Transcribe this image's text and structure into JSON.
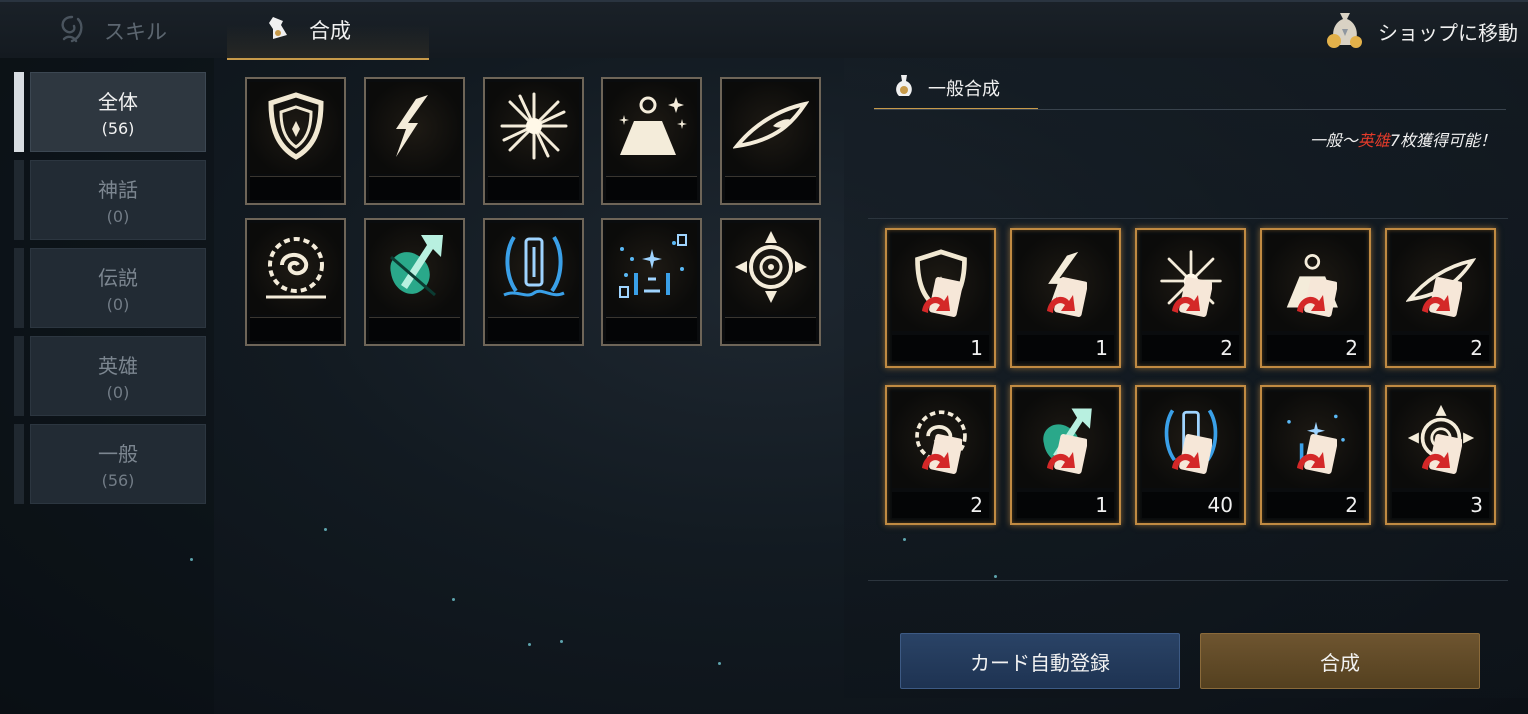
{
  "header": {
    "tabs": [
      {
        "label": "スキル",
        "active": false
      },
      {
        "label": "合成",
        "active": true
      }
    ],
    "shop_label": "ショップに移動"
  },
  "sidebar": {
    "items": [
      {
        "label": "全体",
        "count": "(56)",
        "active": true
      },
      {
        "label": "神話",
        "count": "(0)",
        "active": false
      },
      {
        "label": "伝説",
        "count": "(0)",
        "active": false
      },
      {
        "label": "英雄",
        "count": "(0)",
        "active": false
      },
      {
        "label": "一般",
        "count": "(56)",
        "active": false
      }
    ]
  },
  "card_grid": {
    "cards": [
      {
        "icon": "shield-icon"
      },
      {
        "icon": "lightning-icon"
      },
      {
        "icon": "burst-icon"
      },
      {
        "icon": "weight-icon"
      },
      {
        "icon": "eye-icon"
      },
      {
        "icon": "sun-spiral-icon"
      },
      {
        "icon": "green-leaf-icon"
      },
      {
        "icon": "blue-pillar-icon"
      },
      {
        "icon": "blue-sparkle-icon"
      },
      {
        "icon": "target-icon"
      }
    ]
  },
  "synthesis": {
    "tab_label": "一般合成",
    "note_prefix": "一般～",
    "note_highlight": "英雄",
    "note_suffix": "7枚獲得可能！",
    "highlight_color": "#e23a2a",
    "materials": [
      {
        "icon": "shield-icon",
        "count": "1"
      },
      {
        "icon": "lightning-icon",
        "count": "1"
      },
      {
        "icon": "burst-icon",
        "count": "2"
      },
      {
        "icon": "weight-icon",
        "count": "2"
      },
      {
        "icon": "eye-icon",
        "count": "2"
      },
      {
        "icon": "sun-spiral-icon",
        "count": "2"
      },
      {
        "icon": "green-leaf-icon",
        "count": "1"
      },
      {
        "icon": "blue-pillar-icon",
        "count": "40"
      },
      {
        "icon": "blue-sparkle-icon",
        "count": "2"
      },
      {
        "icon": "target-icon",
        "count": "3"
      }
    ],
    "auto_register_label": "カード自動登録",
    "synth_label": "合成"
  },
  "colors": {
    "accent_gold": "#c79a4a",
    "button_blue": "#1e3352",
    "button_gold": "#54401f"
  }
}
